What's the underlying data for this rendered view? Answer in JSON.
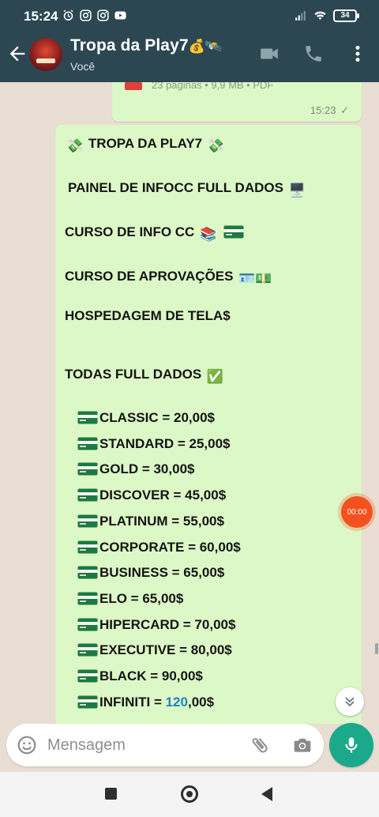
{
  "status_bar": {
    "time": "15:24",
    "battery": "34",
    "left_icons": [
      "alarm-icon",
      "instagram-icon",
      "instagram-icon",
      "youtube-icon"
    ],
    "right_icons": [
      "signal-icon",
      "wifi-icon",
      "battery-icon"
    ]
  },
  "header": {
    "title": "Tropa da Play7",
    "title_emoji": "💰🛰️",
    "subtitle": "Você",
    "icons": [
      "video-call-icon",
      "phone-icon",
      "more-vert-icon"
    ]
  },
  "previous_message": {
    "doc_meta": "23 páginas • 9,9 MB • PDF",
    "time": "15:23",
    "ticks": "✓"
  },
  "message": {
    "heading": "TROPA DA PLAY7",
    "heading_emoji": "💸",
    "line_painel": "PAINEL DE INFOCC FULL DADOS",
    "line_painel_emoji": "🖥️",
    "line_curso_info": "CURSO DE INFO CC",
    "line_curso_info_emoji": "📚",
    "line_curso_aprov": "CURSO DE APROVAÇÕES",
    "line_curso_aprov_emoji": "🪪💵",
    "line_hospedagem": "HOSPEDAGEM DE TELA$",
    "line_todas": "TODAS FULL DADOS",
    "line_todas_emoji": "✅",
    "items": [
      "CLASSIC = 20,00$",
      "STANDARD = 25,00$",
      "GOLD = 30,00$",
      "DISCOVER = 45,00$",
      "PLATINUM = 55,00$",
      "CORPORATE = 60,00$",
      "BUSINESS = 65,00$",
      "ELO = 65,00$",
      "HIPERCARD = 70,00$",
      "EXECUTIVE = 80,00$",
      "BLACK = 90,00$"
    ],
    "last_item_prefix": "INFINITI = ",
    "last_item_link": "120",
    "last_item_suffix": ",00$"
  },
  "overlay_timer": "00:00",
  "composer": {
    "placeholder": "Mensagem"
  },
  "colors": {
    "header": "#2c4752",
    "chat_bg": "#e9ded3",
    "bubble_out": "#dcf8c6",
    "mic": "#1aa98b",
    "link": "#1f80c9"
  }
}
